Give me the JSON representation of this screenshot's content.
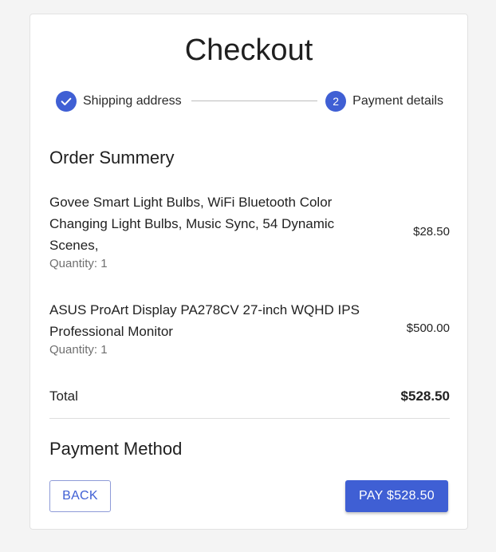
{
  "page_title": "Checkout",
  "stepper": {
    "steps": [
      {
        "label": "Shipping address",
        "status": "completed",
        "icon": "check-icon"
      },
      {
        "label": "Payment details",
        "status": "active",
        "number": "2"
      }
    ]
  },
  "order_summary": {
    "title": "Order Summery",
    "items": [
      {
        "name": "Govee Smart Light Bulbs, WiFi Bluetooth Color Changing Light Bulbs, Music Sync, 54 Dynamic Scenes,",
        "quantity": "Quantity: 1",
        "price": "$28.50"
      },
      {
        "name": "ASUS ProArt Display PA278CV 27-inch WQHD IPS Professional Monitor",
        "quantity": "Quantity: 1",
        "price": "$500.00"
      }
    ],
    "total_label": "Total",
    "total_value": "$528.50"
  },
  "payment_method": {
    "title": "Payment Method"
  },
  "actions": {
    "back_label": "BACK",
    "pay_label": "PAY $528.50"
  },
  "colors": {
    "primary": "#3f5fd4",
    "background": "#f4f4f4",
    "card": "#ffffff"
  }
}
